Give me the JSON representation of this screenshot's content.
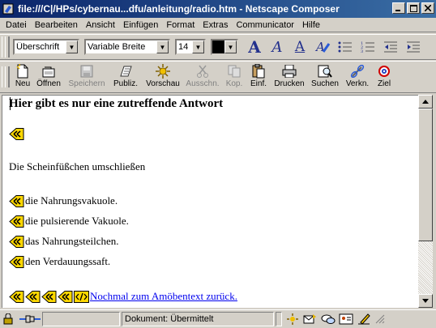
{
  "window": {
    "title": "file:///C|/HPs/cybernau...dfu/anleitung/radio.htm - Netscape Composer",
    "buttons": {
      "minimize": "_",
      "maximize": "□",
      "close": "×"
    }
  },
  "menu": [
    {
      "label": "Datei"
    },
    {
      "label": "Bearbeiten"
    },
    {
      "label": "Ansicht"
    },
    {
      "label": "Einfügen"
    },
    {
      "label": "Format"
    },
    {
      "label": "Extras"
    },
    {
      "label": "Communicator"
    },
    {
      "label": "Hilfe"
    }
  ],
  "format": {
    "paragraph_style": "Überschrift",
    "font": "Variable Breite",
    "size": "14",
    "color": "#000000"
  },
  "toolbar": [
    {
      "label": "Neu",
      "icon": "new-doc-icon",
      "enabled": true
    },
    {
      "label": "Öffnen",
      "icon": "open-icon",
      "enabled": true
    },
    {
      "label": "Speichern",
      "icon": "save-icon",
      "enabled": false
    },
    {
      "label": "Publiz.",
      "icon": "publish-icon",
      "enabled": true
    },
    {
      "label": "Vorschau",
      "icon": "preview-icon",
      "enabled": true
    },
    {
      "label": "Ausschn.",
      "icon": "cut-icon",
      "enabled": false
    },
    {
      "label": "Kop.",
      "icon": "copy-icon",
      "enabled": false
    },
    {
      "label": "Einf.",
      "icon": "paste-icon",
      "enabled": true
    },
    {
      "label": "Drucken",
      "icon": "print-icon",
      "enabled": true
    },
    {
      "label": "Suchen",
      "icon": "find-icon",
      "enabled": true
    },
    {
      "label": "Verkn.",
      "icon": "link-icon",
      "enabled": true
    },
    {
      "label": "Ziel",
      "icon": "target-icon",
      "enabled": true
    }
  ],
  "document": {
    "heading": "Hier gibt es nur eine zutreffende Antwort",
    "question": "Die Scheinfüßchen umschließen",
    "answers": [
      "die Nahrungsvakuole.",
      "die pulsierende Vakuole.",
      "das Nahrungsteilchen.",
      "den Verdauungssaft."
    ],
    "back_link": "Nochmal zum Amöbentext zurück."
  },
  "status": {
    "text": "Dokument: Übermittelt"
  },
  "colors": {
    "title_start": "#0a246a",
    "title_end": "#3a6ea5",
    "link": "#0000ee",
    "anchor_fill": "#ffd800"
  }
}
